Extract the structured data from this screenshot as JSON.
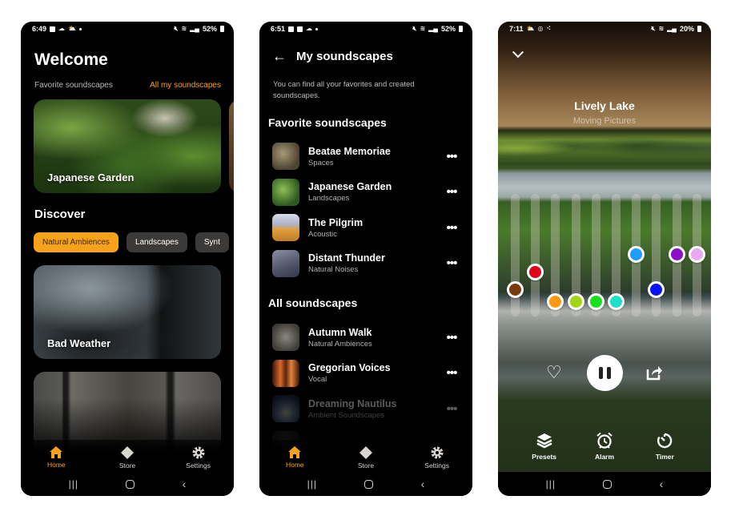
{
  "screens": {
    "home": {
      "status": {
        "time": "6:49",
        "battery": "52%"
      },
      "title": "Welcome",
      "favorites_label": "Favorite soundscapes",
      "all_link": "All my soundscapes",
      "favorite_cards": [
        {
          "title": "Japanese Garden"
        }
      ],
      "discover_title": "Discover",
      "chips": [
        {
          "label": "Natural Ambiences",
          "active": true
        },
        {
          "label": "Landscapes",
          "active": false
        },
        {
          "label": "Synt",
          "active": false
        }
      ],
      "discover_cards": [
        {
          "title": "Bad Weather"
        },
        {
          "title": ""
        }
      ]
    },
    "my_soundscapes": {
      "status": {
        "time": "6:51",
        "battery": "52%"
      },
      "title": "My soundscapes",
      "description": "You can find all your favorites and created soundscapes.",
      "favorites_title": "Favorite soundscapes",
      "favorites": [
        {
          "title": "Beatae Memoriae",
          "category": "Spaces"
        },
        {
          "title": "Japanese Garden",
          "category": "Landscapes"
        },
        {
          "title": "The Pilgrim",
          "category": "Acoustic"
        },
        {
          "title": "Distant Thunder",
          "category": "Natural Noises"
        }
      ],
      "all_title": "All soundscapes",
      "all": [
        {
          "title": "Autumn Walk",
          "category": "Natural Ambiences"
        },
        {
          "title": "Gregorian Voices",
          "category": "Vocal"
        },
        {
          "title": "Dreaming Nautilus",
          "category": "Ambient Soundscapes"
        }
      ],
      "more_glyph": "•••"
    },
    "player": {
      "status": {
        "time": "7:11",
        "battery": "20%"
      },
      "title": "Lively Lake",
      "artist": "Moving Pictures",
      "mixer_levels": [
        {
          "color": "#7a3a0c",
          "level": 0.15
        },
        {
          "color": "#e3001b",
          "level": 0.33
        },
        {
          "color": "#ff9a10",
          "level": 0.03
        },
        {
          "color": "#a4d416",
          "level": 0.03
        },
        {
          "color": "#18de20",
          "level": 0.03
        },
        {
          "color": "#1ce0c8",
          "level": 0.03
        },
        {
          "color": "#1e9bff",
          "level": 0.51
        },
        {
          "color": "#0a14f0",
          "level": 0.15
        },
        {
          "color": "#8c10c8",
          "level": 0.51
        },
        {
          "color": "#e8a8f2",
          "level": 0.51
        }
      ],
      "tools": [
        {
          "label": "Presets",
          "icon": "layers-icon"
        },
        {
          "label": "Alarm",
          "icon": "alarm-icon"
        },
        {
          "label": "Timer",
          "icon": "timer-icon"
        }
      ]
    }
  },
  "bottom_nav": [
    {
      "label": "Home",
      "icon": "home-icon",
      "active": true
    },
    {
      "label": "Store",
      "icon": "diamond-icon",
      "active": false
    },
    {
      "label": "Settings",
      "icon": "gear-icon",
      "active": false
    }
  ],
  "colors": {
    "accent": "#f7a21b",
    "chip_bg": "#3c3a38"
  }
}
